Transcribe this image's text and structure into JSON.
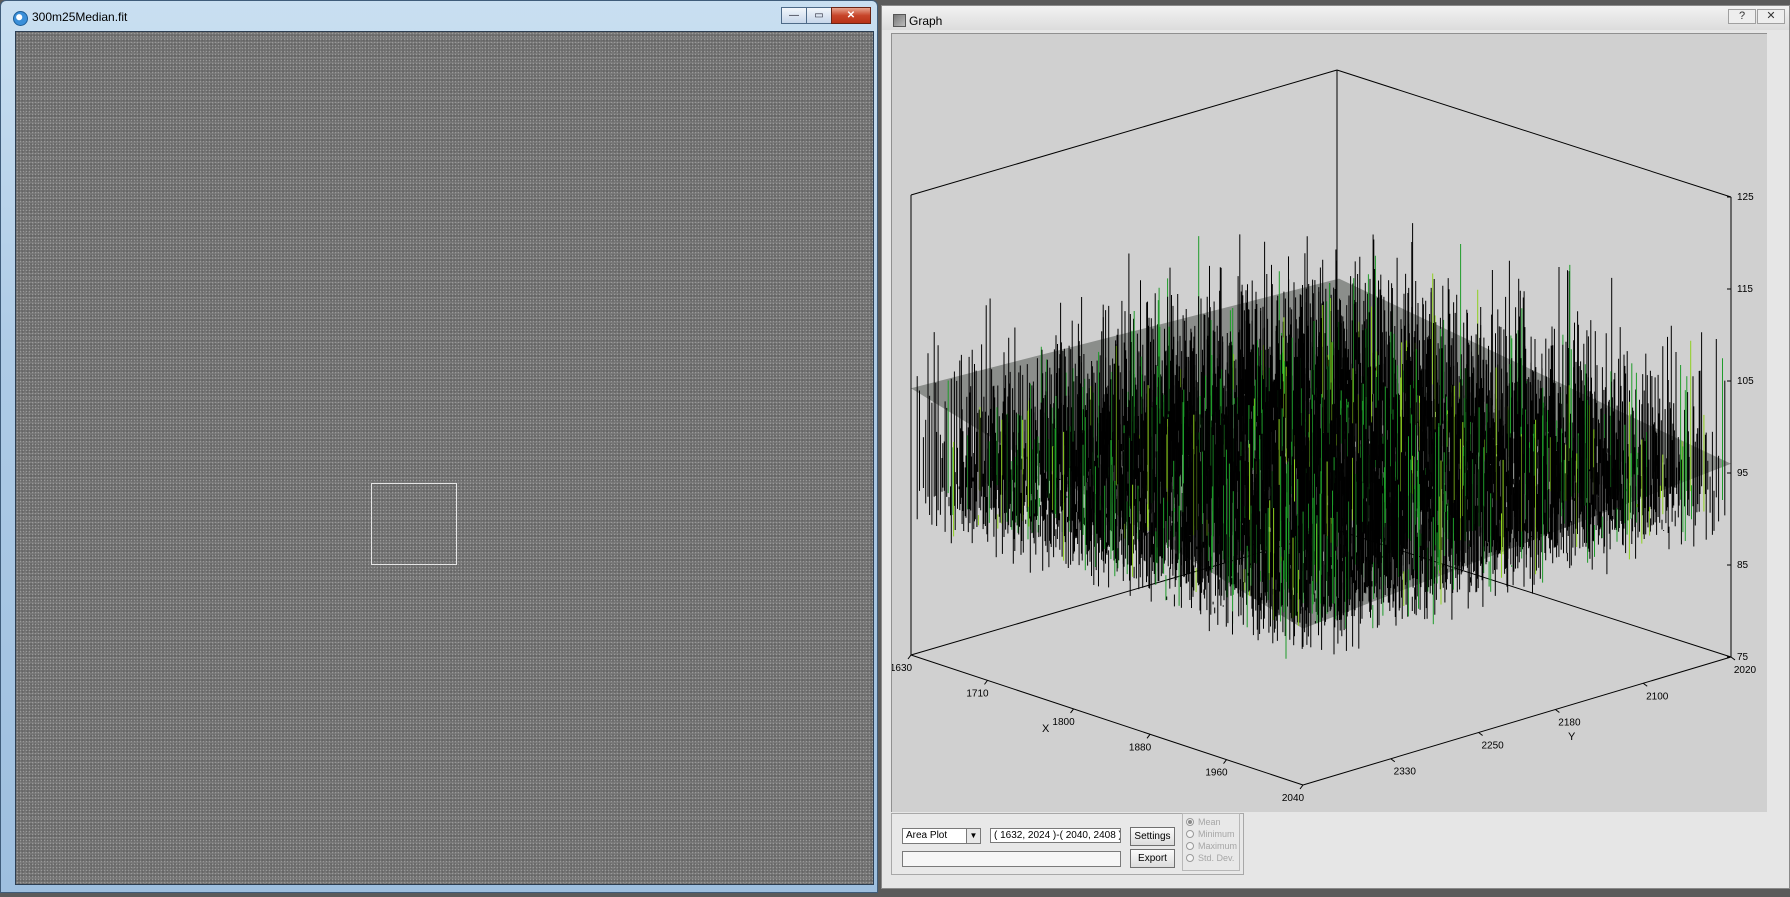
{
  "image_window": {
    "title": "300m25Median.fit",
    "buttons": {
      "minimize": "—",
      "maximize": "▭",
      "close": "✕"
    }
  },
  "graph_window": {
    "title": "Graph",
    "buttons": {
      "help": "?",
      "close": "✕"
    },
    "plot_type": "Area Plot",
    "region": "( 1632, 2024 )-( 2040, 2408 )",
    "settings_label": "Settings",
    "export_label": "Export",
    "statistic_options": [
      {
        "label": "Mean",
        "selected": true
      },
      {
        "label": "Minimum",
        "selected": false
      },
      {
        "label": "Maximum",
        "selected": false
      },
      {
        "label": "Std. Dev.",
        "selected": false
      }
    ]
  },
  "chart_data": {
    "type": "area",
    "z_ticks": [
      "125",
      "115",
      "105",
      "95",
      "85",
      "75"
    ],
    "zlim": [
      75,
      125
    ],
    "x_ticks": [
      "1630",
      "1710",
      "1800",
      "1880",
      "1960",
      "2040"
    ],
    "y_ticks": [
      "2020",
      "2100",
      "2180",
      "2250",
      "2330"
    ],
    "xlabel": "X",
    "ylabel": "Y",
    "xlim": [
      1630,
      2040
    ],
    "ylim": [
      2020,
      2410
    ],
    "surface_mean": 100,
    "surface_noise_range": [
      78,
      124
    ],
    "colors": {
      "surface_edge": "#000000",
      "surface_fill": "#1e9c2a",
      "highlight": "#8fd11e",
      "background": "#d0d0d0"
    }
  }
}
